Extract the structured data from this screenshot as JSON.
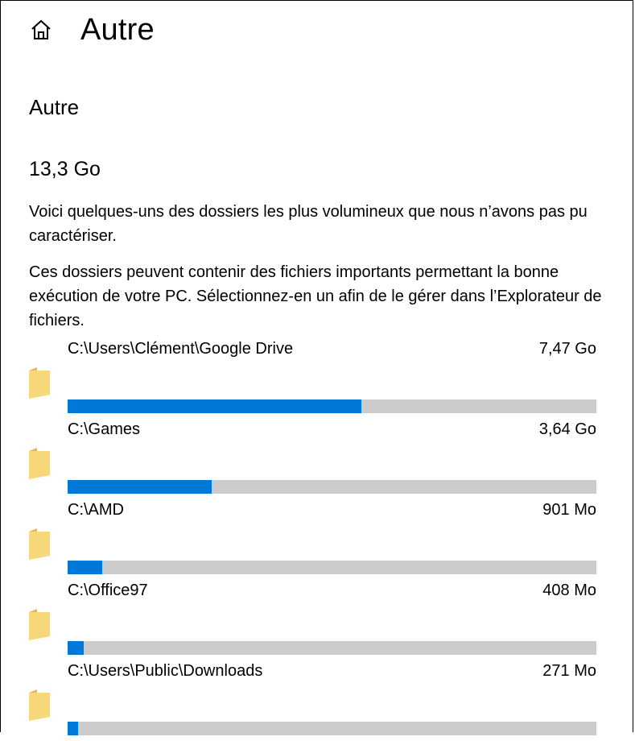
{
  "header": {
    "title": "Autre",
    "home_icon": "home-icon"
  },
  "section": {
    "title": "Autre",
    "total_size": "13,3 Go",
    "description_1": "Voici quelques-uns des dossiers les plus volumineux que nous n’avons pas pu caractériser.",
    "description_2": "Ces dossiers peuvent contenir des fichiers importants permettant la bonne exécution de votre PC. Sélectionnez-en un afin de le gérer dans l’Explorateur de fichiers."
  },
  "colors": {
    "accent": "#0078d7",
    "track": "#cccccc",
    "folder": "#f4ce62"
  },
  "folders": [
    {
      "path": "C:\\Users\\Clément\\Google Drive",
      "size": "7,47 Go",
      "fraction": 0.555,
      "icon": "folder-icon"
    },
    {
      "path": "C:\\Games",
      "size": "3,64 Go",
      "fraction": 0.272,
      "icon": "folder-icon"
    },
    {
      "path": "C:\\AMD",
      "size": "901 Mo",
      "fraction": 0.066,
      "icon": "folder-icon"
    },
    {
      "path": "C:\\Office97",
      "size": "408 Mo",
      "fraction": 0.03,
      "icon": "folder-icon"
    },
    {
      "path": "C:\\Users\\Public\\Downloads",
      "size": "271 Mo",
      "fraction": 0.02,
      "icon": "folder-icon"
    }
  ]
}
